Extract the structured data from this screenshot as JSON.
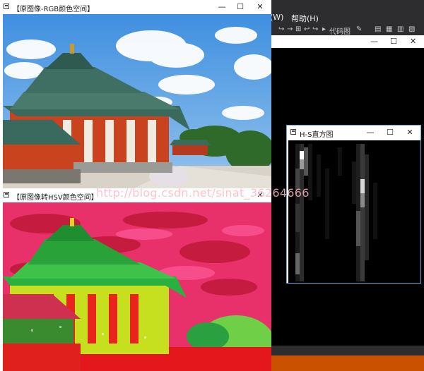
{
  "ide": {
    "menu_window": "(W)",
    "menu_help": "帮助(H)",
    "toolbar_code_map": "代码图"
  },
  "windows": {
    "rgb": {
      "title": "【原图像-RGB颜色空间】"
    },
    "hsv": {
      "title": "【原图像转HSV颜色空间】"
    },
    "hist": {
      "title": "H-S直方图"
    }
  },
  "controls": {
    "minimize": "—",
    "maximize": "☐",
    "close": "✕"
  },
  "watermark": "http://blog.csdn.net/sinat_36264666"
}
